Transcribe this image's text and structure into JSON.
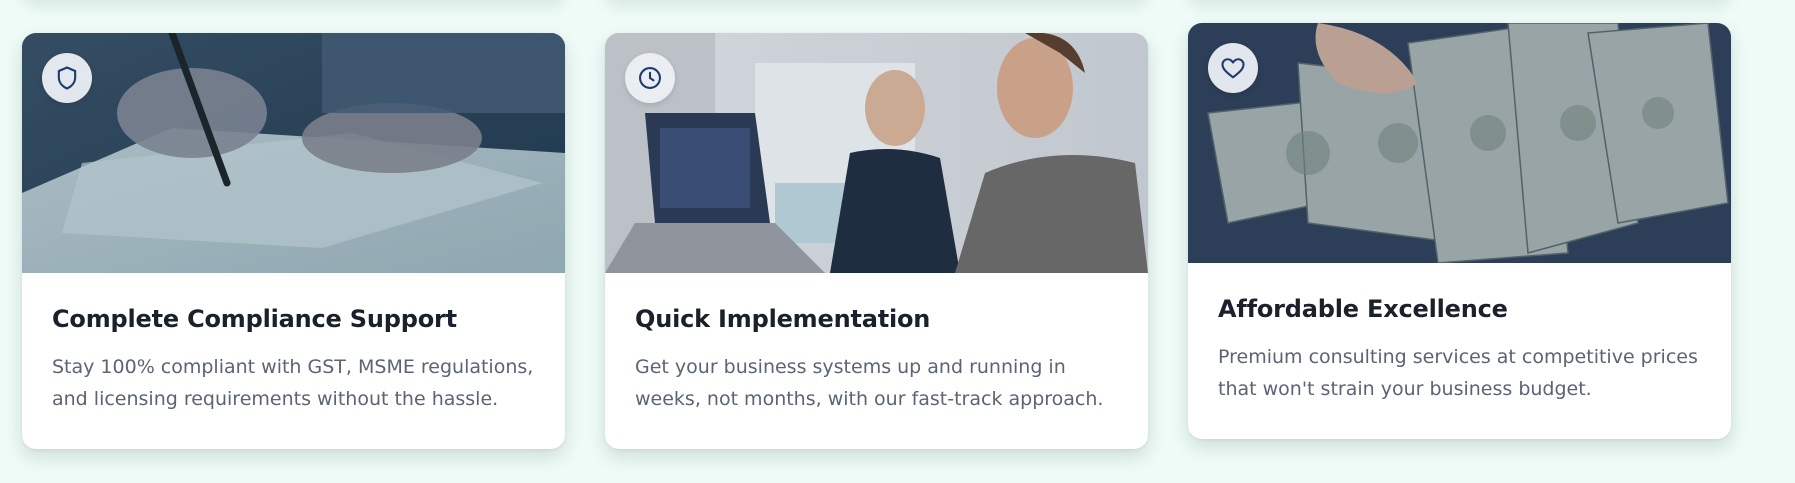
{
  "cards": [
    {
      "icon": "shield-icon",
      "title": "Complete Compliance Support",
      "description": "Stay 100% compliant with GST, MSME regulations, and licensing requirements without the hassle."
    },
    {
      "icon": "clock-icon",
      "title": "Quick Implementation",
      "description": "Get your business systems up and running in weeks, not months, with our fast-track approach."
    },
    {
      "icon": "heart-icon",
      "title": "Affordable Excellence",
      "description": "Premium consulting services at competitive prices that won't strain your business budget."
    }
  ],
  "colors": {
    "page_background": "#eefbf6",
    "icon_stroke": "#1e3a6e",
    "title": "#1a202c",
    "description": "#5b6475"
  }
}
